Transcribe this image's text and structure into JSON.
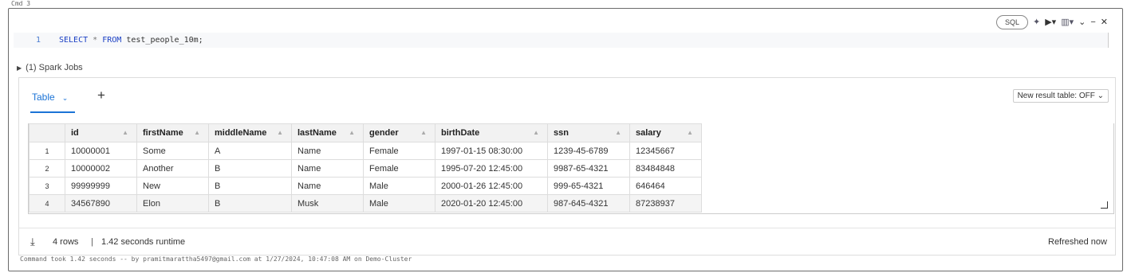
{
  "cmd_label": "Cmd 3",
  "toolbar": {
    "language": "SQL",
    "icons": [
      "sparkle-icon",
      "run-icon",
      "chart-icon",
      "collapse-icon",
      "minimize-icon",
      "close-icon"
    ]
  },
  "editor": {
    "line_number": "1",
    "code_keyword1": "SELECT",
    "code_star": "*",
    "code_keyword2": "FROM",
    "code_table": "test_people_10m;"
  },
  "spark_jobs": "(1) Spark Jobs",
  "result": {
    "tab_label": "Table",
    "new_result_toggle": "New result table: OFF",
    "columns": [
      "id",
      "firstName",
      "middleName",
      "lastName",
      "gender",
      "birthDate",
      "ssn",
      "salary"
    ],
    "rows": [
      {
        "n": "1",
        "cells": [
          "10000001",
          "Some",
          "A",
          "Name",
          "Female",
          "1997-01-15 08:30:00",
          "1239-45-6789",
          "12345667"
        ]
      },
      {
        "n": "2",
        "cells": [
          "10000002",
          "Another",
          "B",
          "Name",
          "Female",
          "1995-07-20 12:45:00",
          "9987-65-4321",
          "83484848"
        ]
      },
      {
        "n": "3",
        "cells": [
          "99999999",
          "New",
          "B",
          "Name",
          "Male",
          "2000-01-26 12:45:00",
          "999-65-4321",
          "646464"
        ]
      },
      {
        "n": "4",
        "cells": [
          "34567890",
          "Elon",
          "B",
          "Musk",
          "Male",
          "2020-01-20 12:45:00",
          "987-645-4321",
          "87238937"
        ]
      }
    ],
    "row_count": "4 rows",
    "separator": "|",
    "runtime": "1.42 seconds runtime",
    "refreshed": "Refreshed now"
  },
  "command_footer": "Command took 1.42 seconds -- by pramitmarattha5497@gmail.com at 1/27/2024, 10:47:08 AM on Demo-Cluster"
}
